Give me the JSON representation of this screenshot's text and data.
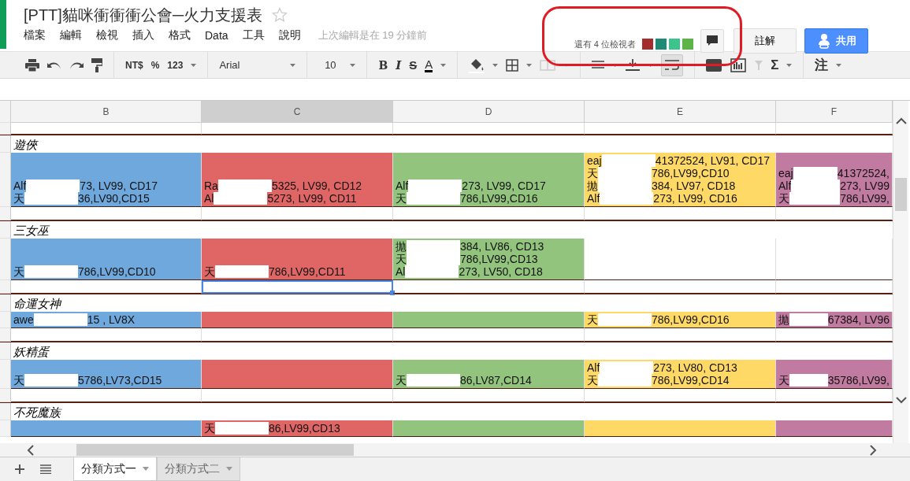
{
  "document": {
    "title": "[PTT]貓咪衝衝衝公會─火力支援表",
    "starred": false
  },
  "menu": [
    "檔案",
    "編輯",
    "檢視",
    "插入",
    "格式",
    "Data",
    "工具",
    "說明"
  ],
  "last_edit": "上次編輯是在 19 分鐘前",
  "viewers": {
    "label": "還有 4 位檢視者",
    "avatars": [
      {
        "color": "#a32c2c"
      },
      {
        "color": "#1e8a76"
      },
      {
        "color": "#3cc48e"
      },
      {
        "color": "#5db548"
      }
    ]
  },
  "buttons": {
    "comments": "註解",
    "share": "共用"
  },
  "toolbar": {
    "currency": "NT$",
    "percent": "%",
    "number_format": "123",
    "font": "Arial",
    "font_size": "10",
    "bold": "B",
    "italic": "I",
    "strike": "S",
    "text_color": "A",
    "functions": "Σ",
    "note": "注",
    "wrap_on": true
  },
  "columns": [
    {
      "label": "B",
      "selected": false
    },
    {
      "label": "C",
      "selected": true
    },
    {
      "label": "D",
      "selected": false
    },
    {
      "label": "E",
      "selected": false
    },
    {
      "label": "F",
      "selected": false
    }
  ],
  "sections": [
    {
      "title": "遊俠",
      "cells": [
        {
          "color": "#6fa8dc",
          "lines": [
            {
              "pre": "Alf",
              "post": "73, LV99, CD17"
            },
            {
              "pre": "天",
              "post": "36,LV90,CD15"
            }
          ]
        },
        {
          "color": "#e06666",
          "lines": [
            {
              "pre": "Ra",
              "post": "5325, LV99, CD12"
            },
            {
              "pre": "Al",
              "post": "5273, LV99, CD11"
            }
          ]
        },
        {
          "color": "#93c47d",
          "lines": [
            {
              "pre": "Alf",
              "post": "273, LV99, CD17"
            },
            {
              "pre": "天",
              "post": "786,LV99,CD16"
            }
          ]
        },
        {
          "color": "#ffd966",
          "lines": [
            {
              "pre": "eaj",
              "post": "41372524, LV91, CD17"
            },
            {
              "pre": "天",
              "post": "786,LV99,CD10"
            },
            {
              "pre": "拋",
              "post": "384, LV97, CD18"
            },
            {
              "pre": "Alf",
              "post": "273, LV99, CD16"
            }
          ]
        },
        {
          "color": "#c27ba0",
          "lines": [
            {
              "pre": "eaj",
              "post": "41372524,"
            },
            {
              "pre": "Alf",
              "post": "273, LV99"
            },
            {
              "pre": "天",
              "post": "786,LV99,"
            }
          ]
        }
      ],
      "gap": [
        {
          "selected": false
        },
        {
          "selected": false
        },
        {
          "selected": false
        },
        {
          "selected": false
        },
        {
          "selected": false
        }
      ]
    },
    {
      "title": "三女巫",
      "cells": [
        {
          "color": "#6fa8dc",
          "lines": [
            {
              "pre": "天",
              "post": "786,LV99,CD10"
            }
          ]
        },
        {
          "color": "#e06666",
          "lines": [
            {
              "pre": "天",
              "post": "786,LV99,CD11"
            }
          ]
        },
        {
          "color": "#93c47d",
          "lines": [
            {
              "pre": "拋",
              "post": "384, LV86, CD13"
            },
            {
              "pre": "天",
              "post": "786,LV99,CD13"
            },
            {
              "pre": "Al",
              "post": "273, LV50, CD18"
            }
          ]
        },
        {
          "color": "#ffffff"
        },
        {
          "color": "#ffffff"
        }
      ],
      "gap": [
        {
          "selected": false
        },
        {
          "selected": true
        },
        {
          "selected": false
        },
        {
          "selected": false
        },
        {
          "selected": false
        }
      ]
    },
    {
      "title": "命運女神",
      "cells": [
        {
          "color": "#6fa8dc",
          "lines": [
            {
              "pre": "awe",
              "post": "15 , LV8X"
            }
          ]
        },
        {
          "color": "#e06666"
        },
        {
          "color": "#93c47d"
        },
        {
          "color": "#ffd966",
          "lines": [
            {
              "pre": "天",
              "post": "786,LV99,CD16"
            }
          ]
        },
        {
          "color": "#c27ba0",
          "lines": [
            {
              "pre": "拋",
              "post": "67384, LV96"
            }
          ]
        }
      ],
      "gap": [
        {
          "selected": false
        },
        {
          "selected": false
        },
        {
          "selected": false
        },
        {
          "selected": false
        },
        {
          "selected": false
        }
      ]
    },
    {
      "title": "妖精蛋",
      "cells": [
        {
          "color": "#6fa8dc",
          "lines": [
            {
              "pre": "天",
              "post": "5786,LV73,CD15"
            }
          ]
        },
        {
          "color": "#e06666"
        },
        {
          "color": "#93c47d",
          "lines": [
            {
              "pre": "天",
              "post": "86,LV87,CD14"
            }
          ]
        },
        {
          "color": "#ffd966",
          "lines": [
            {
              "pre": "Alf",
              "post": "273, LV80, CD13"
            },
            {
              "pre": "天",
              "post": "786,LV99,CD14"
            }
          ]
        },
        {
          "color": "#c27ba0",
          "lines": [
            {
              "pre": "天",
              "post": "35786,LV99,"
            }
          ]
        }
      ],
      "gap": [
        {
          "selected": false
        },
        {
          "selected": false
        },
        {
          "selected": false
        },
        {
          "selected": false
        },
        {
          "selected": false
        }
      ]
    },
    {
      "title": "不死魔族",
      "cells": [
        {
          "color": "#6fa8dc"
        },
        {
          "color": "#e06666",
          "lines": [
            {
              "pre": "天",
              "post": "86,LV99,CD13"
            }
          ]
        },
        {
          "color": "#93c47d"
        },
        {
          "color": "#ffd966"
        },
        {
          "color": "#c27ba0"
        }
      ]
    }
  ],
  "sheets": [
    {
      "label": "分類方式一",
      "selected": true
    },
    {
      "label": "分類方式二",
      "selected": false
    }
  ]
}
